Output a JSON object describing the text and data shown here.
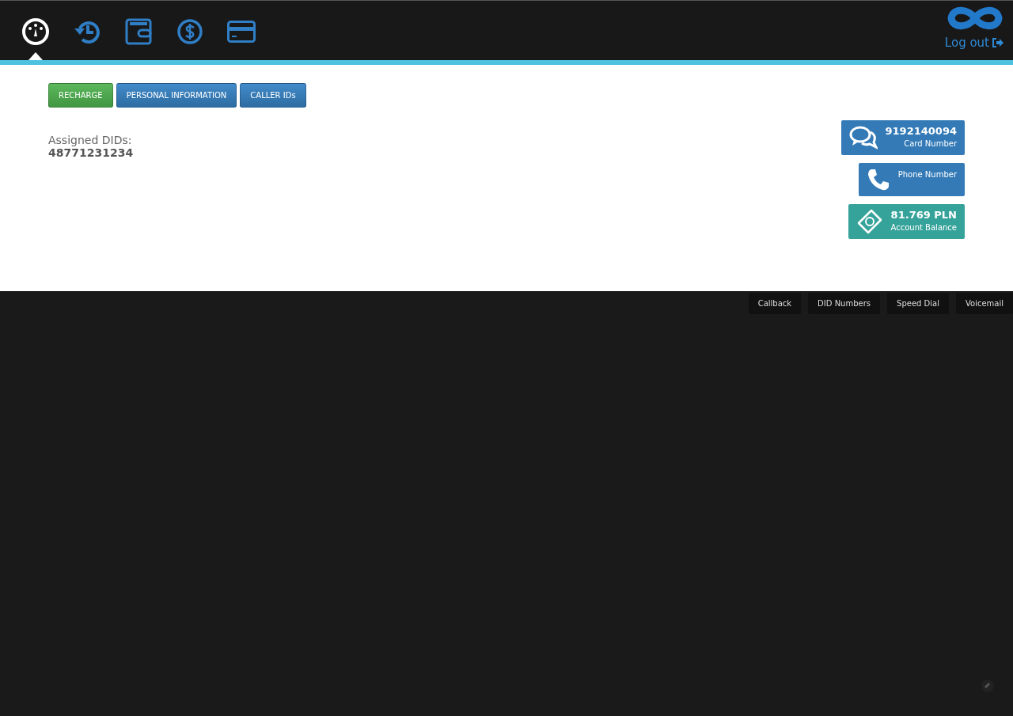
{
  "nav": [
    {
      "kind": "gauge",
      "selected": true
    },
    {
      "kind": "history",
      "selected": false
    },
    {
      "kind": "wallet",
      "selected": false
    },
    {
      "kind": "dollar",
      "selected": false
    },
    {
      "kind": "card",
      "selected": false
    }
  ],
  "logout": "Log out",
  "buttons": [
    {
      "label": "RECHARGE",
      "kind": "success"
    },
    {
      "label": "PERSONAL INFORMATION",
      "kind": "primary"
    },
    {
      "label": "CALLER IDs",
      "kind": "primary"
    }
  ],
  "assigned_dids": {
    "label": "Assigned DIDs:",
    "value": "48771231234"
  },
  "info_cards": [
    {
      "kind": "chat",
      "value": "9192140094",
      "label": "Card Number"
    },
    {
      "kind": "phone",
      "label": "Phone Number"
    },
    {
      "kind": "money",
      "value": "81.769 PLN",
      "label": "Account Balance"
    }
  ],
  "footer_tabs": [
    "Callback",
    "DID Numbers",
    "Speed Dial",
    "Voicemail"
  ]
}
